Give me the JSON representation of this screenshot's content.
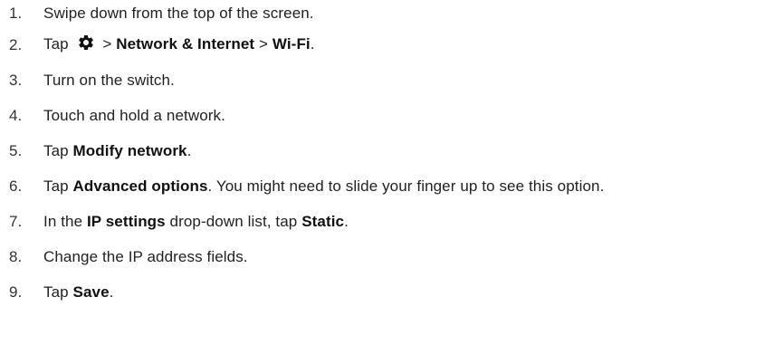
{
  "steps": [
    {
      "num": "1.",
      "parts": [
        {
          "t": "Swipe down from the top of the screen."
        }
      ]
    },
    {
      "num": "2.",
      "parts": [
        {
          "t": "Tap "
        },
        {
          "icon": "settings-gear-icon"
        },
        {
          "t": " > "
        },
        {
          "t": "Network & Internet",
          "b": true
        },
        {
          "t": " > "
        },
        {
          "t": "Wi-Fi",
          "b": true
        },
        {
          "t": "."
        }
      ]
    },
    {
      "num": "3.",
      "parts": [
        {
          "t": "Turn on the switch."
        }
      ]
    },
    {
      "num": "4.",
      "parts": [
        {
          "t": "Touch and hold a network."
        }
      ]
    },
    {
      "num": "5.",
      "parts": [
        {
          "t": "Tap "
        },
        {
          "t": "Modify network",
          "b": true
        },
        {
          "t": "."
        }
      ]
    },
    {
      "num": "6.",
      "parts": [
        {
          "t": "Tap "
        },
        {
          "t": "Advanced options",
          "b": true
        },
        {
          "t": ". You might need to slide your finger up to see this option."
        }
      ]
    },
    {
      "num": "7.",
      "parts": [
        {
          "t": "In the "
        },
        {
          "t": "IP settings",
          "b": true
        },
        {
          "t": " drop-down list, tap "
        },
        {
          "t": "Static",
          "b": true
        },
        {
          "t": "."
        }
      ]
    },
    {
      "num": "8.",
      "parts": [
        {
          "t": "Change the IP address fields."
        }
      ]
    },
    {
      "num": "9.",
      "parts": [
        {
          "t": "Tap "
        },
        {
          "t": "Save",
          "b": true
        },
        {
          "t": "."
        }
      ]
    }
  ]
}
